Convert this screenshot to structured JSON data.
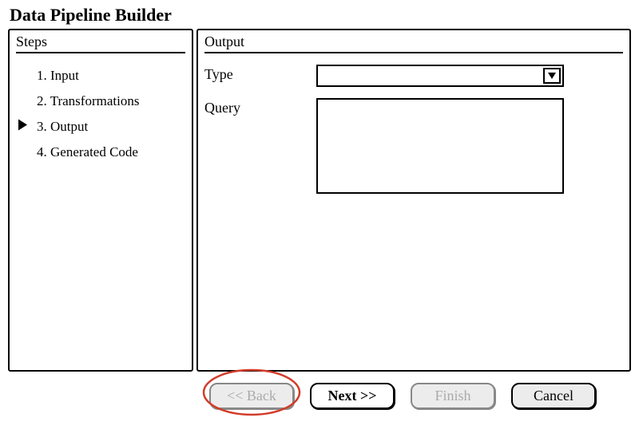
{
  "title": "Data Pipeline Builder",
  "sidebar": {
    "header": "Steps",
    "items": [
      {
        "label": "1. Input",
        "current": false
      },
      {
        "label": "2. Transformations",
        "current": false
      },
      {
        "label": "3. Output",
        "current": true
      },
      {
        "label": "4. Generated Code",
        "current": false
      }
    ]
  },
  "main": {
    "header": "Output",
    "type_label": "Type",
    "type_value": "",
    "query_label": "Query",
    "query_value": ""
  },
  "buttons": {
    "back": "<< Back",
    "next": "Next >>",
    "finish": "Finish",
    "cancel": "Cancel"
  },
  "annotations": {
    "back_highlight_color": "#d23c2a"
  }
}
